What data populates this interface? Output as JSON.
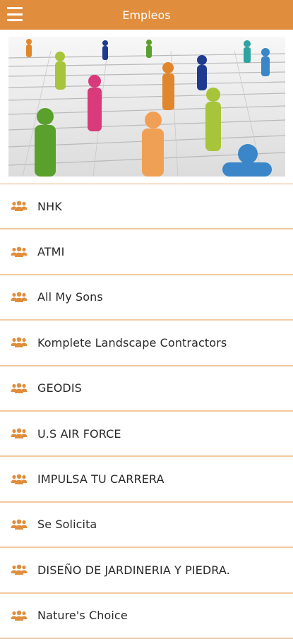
{
  "header": {
    "title": "Empleos",
    "menu_icon": "hamburger-menu-icon"
  },
  "colors": {
    "accent": "#e08e3d",
    "divider": "#f2c9a0",
    "icon": "#e08e3d"
  },
  "banner": {
    "icon": "people-newspaper-image"
  },
  "list": {
    "item_icon": "people-group-icon",
    "items": [
      {
        "label": "NHK"
      },
      {
        "label": "ATMI"
      },
      {
        "label": "All My Sons"
      },
      {
        "label": "Komplete Landscape Contractors"
      },
      {
        "label": "GEODIS"
      },
      {
        "label": "U.S AIR FORCE"
      },
      {
        "label": "IMPULSA TU CARRERA"
      },
      {
        "label": "Se Solicita"
      },
      {
        "label": "DISEÑO DE JARDINERIA Y PIEDRA."
      },
      {
        "label": "Nature's Choice"
      }
    ]
  }
}
